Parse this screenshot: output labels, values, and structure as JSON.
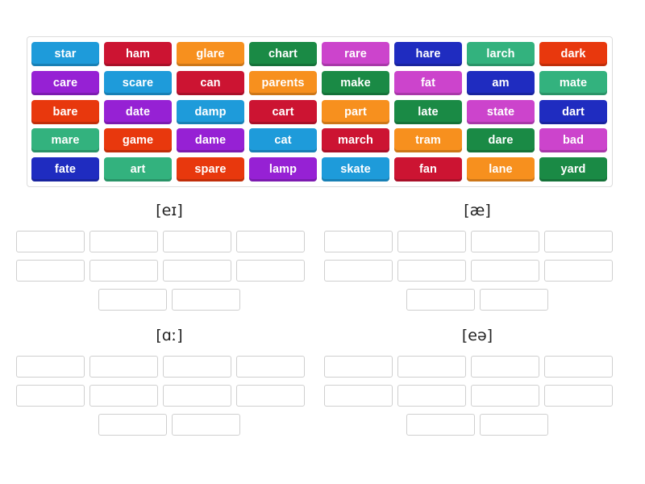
{
  "word_bank": {
    "rows": [
      [
        {
          "label": "star",
          "color": "#1e9bda"
        },
        {
          "label": "ham",
          "color": "#cc1432"
        },
        {
          "label": "glare",
          "color": "#f7901e"
        },
        {
          "label": "chart",
          "color": "#1a8a45"
        },
        {
          "label": "rare",
          "color": "#cc44cc"
        },
        {
          "label": "hare",
          "color": "#1f2cc0"
        },
        {
          "label": "larch",
          "color": "#33b27e"
        },
        {
          "label": "dark",
          "color": "#e8380d"
        }
      ],
      [
        {
          "label": "care",
          "color": "#9621d4"
        },
        {
          "label": "scare",
          "color": "#1e9bda"
        },
        {
          "label": "can",
          "color": "#cc1432"
        },
        {
          "label": "parents",
          "color": "#f7901e"
        },
        {
          "label": "make",
          "color": "#1a8a45"
        },
        {
          "label": "fat",
          "color": "#cc44cc"
        },
        {
          "label": "am",
          "color": "#1f2cc0"
        },
        {
          "label": "mate",
          "color": "#33b27e"
        }
      ],
      [
        {
          "label": "bare",
          "color": "#e8380d"
        },
        {
          "label": "date",
          "color": "#9621d4"
        },
        {
          "label": "damp",
          "color": "#1e9bda"
        },
        {
          "label": "cart",
          "color": "#cc1432"
        },
        {
          "label": "part",
          "color": "#f7901e"
        },
        {
          "label": "late",
          "color": "#1a8a45"
        },
        {
          "label": "state",
          "color": "#cc44cc"
        },
        {
          "label": "dart",
          "color": "#1f2cc0"
        }
      ],
      [
        {
          "label": "mare",
          "color": "#33b27e"
        },
        {
          "label": "game",
          "color": "#e8380d"
        },
        {
          "label": "dame",
          "color": "#9621d4"
        },
        {
          "label": "cat",
          "color": "#1e9bda"
        },
        {
          "label": "march",
          "color": "#cc1432"
        },
        {
          "label": "tram",
          "color": "#f7901e"
        },
        {
          "label": "dare",
          "color": "#1a8a45"
        },
        {
          "label": "bad",
          "color": "#cc44cc"
        }
      ],
      [
        {
          "label": "fate",
          "color": "#1f2cc0"
        },
        {
          "label": "art",
          "color": "#33b27e"
        },
        {
          "label": "spare",
          "color": "#e8380d"
        },
        {
          "label": "lamp",
          "color": "#9621d4"
        },
        {
          "label": "skate",
          "color": "#1e9bda"
        },
        {
          "label": "fan",
          "color": "#cc1432"
        },
        {
          "label": "lane",
          "color": "#f7901e"
        },
        {
          "label": "yard",
          "color": "#1a8a45"
        }
      ]
    ]
  },
  "categories": [
    {
      "title": "[eɪ]",
      "rows": [
        4,
        4,
        2
      ],
      "filled": [
        [],
        [],
        []
      ]
    },
    {
      "title": "[æ]",
      "rows": [
        4,
        4,
        2
      ],
      "filled": [
        [],
        [],
        []
      ]
    },
    {
      "title": "[ɑː]",
      "rows": [
        4,
        4,
        2
      ],
      "filled": [
        [],
        [],
        []
      ]
    },
    {
      "title": "[eə]",
      "rows": [
        4,
        4,
        2
      ],
      "filled": [
        [],
        [],
        []
      ]
    }
  ],
  "theme": {
    "page_background": "#ffffff",
    "bank_border": "#dcdcdc",
    "dropzone_border": "#cfcfcf",
    "title_color": "#222222",
    "tile_text_color": "#ffffff"
  }
}
